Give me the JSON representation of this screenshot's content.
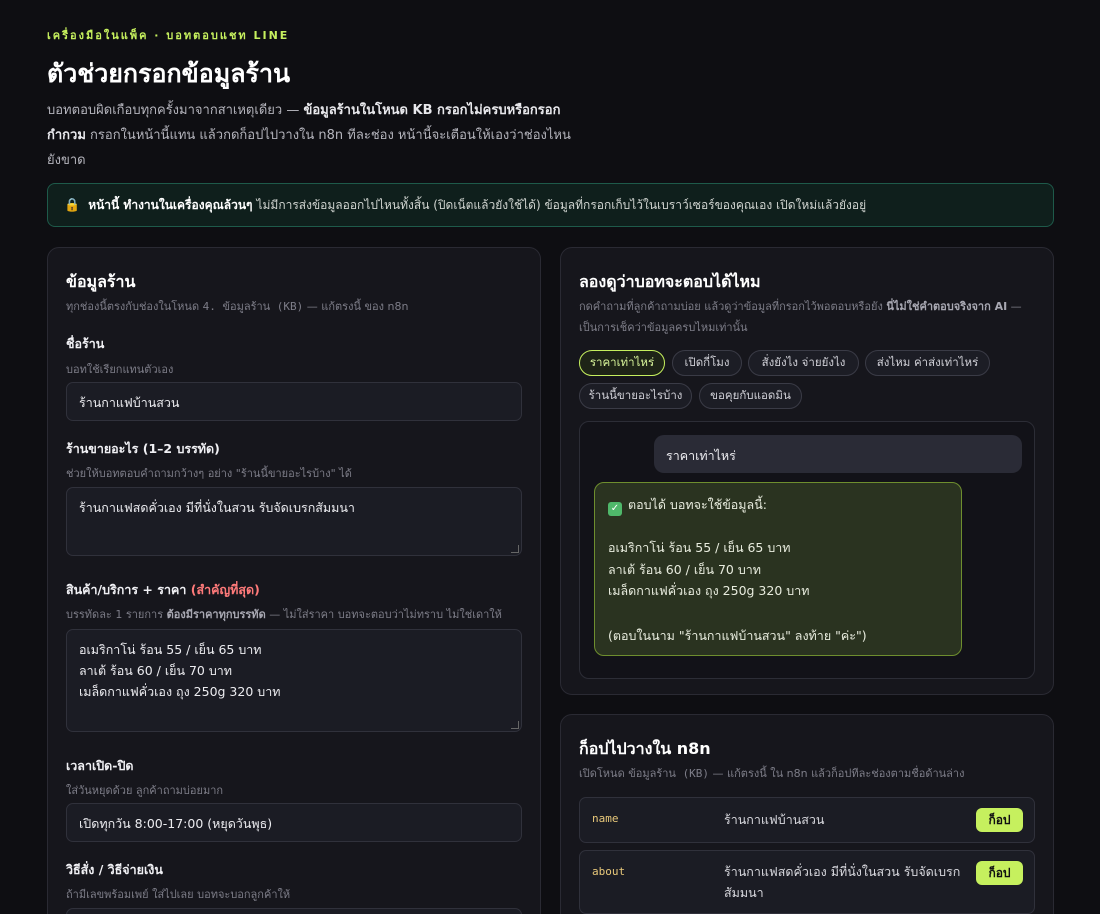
{
  "header": {
    "eyebrow": "เครื่องมือในแพ็ค · บอทตอบแชท LINE",
    "title": "ตัวช่วยกรอกข้อมูลร้าน",
    "intro_1": "บอทตอบผิดเกือบทุกครั้งมาจากสาเหตุเดียว — ",
    "intro_bold": "ข้อมูลร้านในโหนด KB กรอกไม่ครบหรือกรอกกำกวม",
    "intro_2": " กรอกในหน้านี้แทน แล้วกดก็อปไปวางใน n8n ทีละช่อง หน้านี้จะเตือนให้เองว่าช่องไหนยังขาด"
  },
  "notice": {
    "icon": "lock-icon",
    "bold": "หน้านี้ ทำงานในเครื่องคุณล้วนๆ",
    "rest": "ไม่มีการส่งข้อมูลออกไปไหนทั้งสิ้น (ปิดเน็ตแล้วยังใช้ได้) ข้อมูลที่กรอกเก็บไว้ในเบราว์เซอร์ของคุณเอง เปิดใหม่แล้วยังอยู่"
  },
  "shop_form": {
    "title": "ข้อมูลร้าน",
    "subtitle_1": "ทุกช่องนี้ตรงกับช่องในโหนด ",
    "subtitle_mono": "4. ข้อมูลร้าน (KB)",
    "subtitle_2": " — แก้ตรงนี้ ของ n8n",
    "fields": [
      {
        "label": "ชื่อร้าน",
        "hint": "บอทใช้เรียกแทนตัวเอง",
        "value": "ร้านกาแฟบ้านสวน"
      },
      {
        "label": "ร้านขายอะไร (1–2 บรรทัด)",
        "hint": "ช่วยให้บอทตอบคำถามกว้างๆ อย่าง \"ร้านนี้ขายอะไรบ้าง\" ได้",
        "value": "ร้านกาแฟสดคั่วเอง มีที่นั่งในสวน รับจัดเบรกสัมมนา"
      },
      {
        "label": "สินค้า/บริการ + ราคา",
        "label_accent": "(สำคัญที่สุด)",
        "hint_1": "บรรทัดละ 1 รายการ ",
        "hint_bold": "ต้องมีราคาทุกบรรทัด",
        "hint_2": " — ไม่ใส่ราคา บอทจะตอบว่าไม่ทราบ ไม่ใช่เดาให้",
        "value": "อเมริกาโน่ ร้อน 55 / เย็น 65 บาท\nลาเต้ ร้อน 60 / เย็น 70 บาท\nเมล็ดกาแฟคั่วเอง ถุง 250g 320 บาท"
      },
      {
        "label": "เวลาเปิด-ปิด",
        "hint": "ใส่วันหยุดด้วย ลูกค้าถามบ่อยมาก",
        "value": "เปิดทุกวัน 8:00-17:00 (หยุดวันพุธ)"
      },
      {
        "label": "วิธีสั่ง / วิธีจ่ายเงิน",
        "hint": "ถ้ามีเลขพร้อมเพย์ ใส่ไปเลย บอทจะบอกลูกค้าให้",
        "value": ""
      }
    ]
  },
  "try_panel": {
    "title": "ลองดูว่าบอทจะตอบได้ไหม",
    "subtitle_1": "กดคำถามที่ลูกค้าถามบ่อย แล้วดูว่าข้อมูลที่กรอกไว้พอตอบหรือยัง ",
    "subtitle_bold": "นี่ไม่ใช่คำตอบจริงจาก AI",
    "subtitle_2": " — เป็นการเช็คว่าข้อมูลครบไหมเท่านั้น",
    "chips": [
      "ราคาเท่าไหร่",
      "เปิดกี่โมง",
      "สั่งยังไง จ่ายยังไง",
      "ส่งไหม ค่าส่งเท่าไหร่",
      "ร้านนี้ขายอะไรบ้าง",
      "ขอคุยกับแอดมิน"
    ],
    "active_chip": "ราคาเท่าไหร่",
    "question": "ราคาเท่าไหร่",
    "answer_head": "ตอบได้ บอทจะใช้ข้อมูลนี้:",
    "answer_lines": [
      "อเมริกาโน่ ร้อน 55 / เย็น 65 บาท",
      "ลาเต้ ร้อน 60 / เย็น 70 บาท",
      "เมล็ดกาแฟคั่วเอง ถุง 250g 320 บาท"
    ],
    "answer_note": "(ตอบในนาม \"ร้านกาแฟบ้านสวน\" ลงท้าย \"ค่ะ\")"
  },
  "copy_panel": {
    "title": "ก็อปไปวางใน n8n",
    "subtitle_1": "เปิดโหนด ",
    "subtitle_mono": "ข้อมูลร้าน (KB)",
    "subtitle_2": " — แก้ตรงนี้ ใน n8n แล้วก็อปทีละช่องตามชื่อด้านล่าง",
    "rows": [
      {
        "key": "name",
        "value": "ร้านกาแฟบ้านสวน",
        "button": "ก็อป"
      },
      {
        "key": "about",
        "value": "ร้านกาแฟสดคั่วเอง มีที่นั่งในสวน รับจัดเบรกสัมมนา",
        "button": "ก็อป"
      }
    ]
  },
  "colors": {
    "accent": "#c6f05e",
    "background": "#0e0e12",
    "card": "#16161c",
    "warning": "#ff7a7a"
  }
}
